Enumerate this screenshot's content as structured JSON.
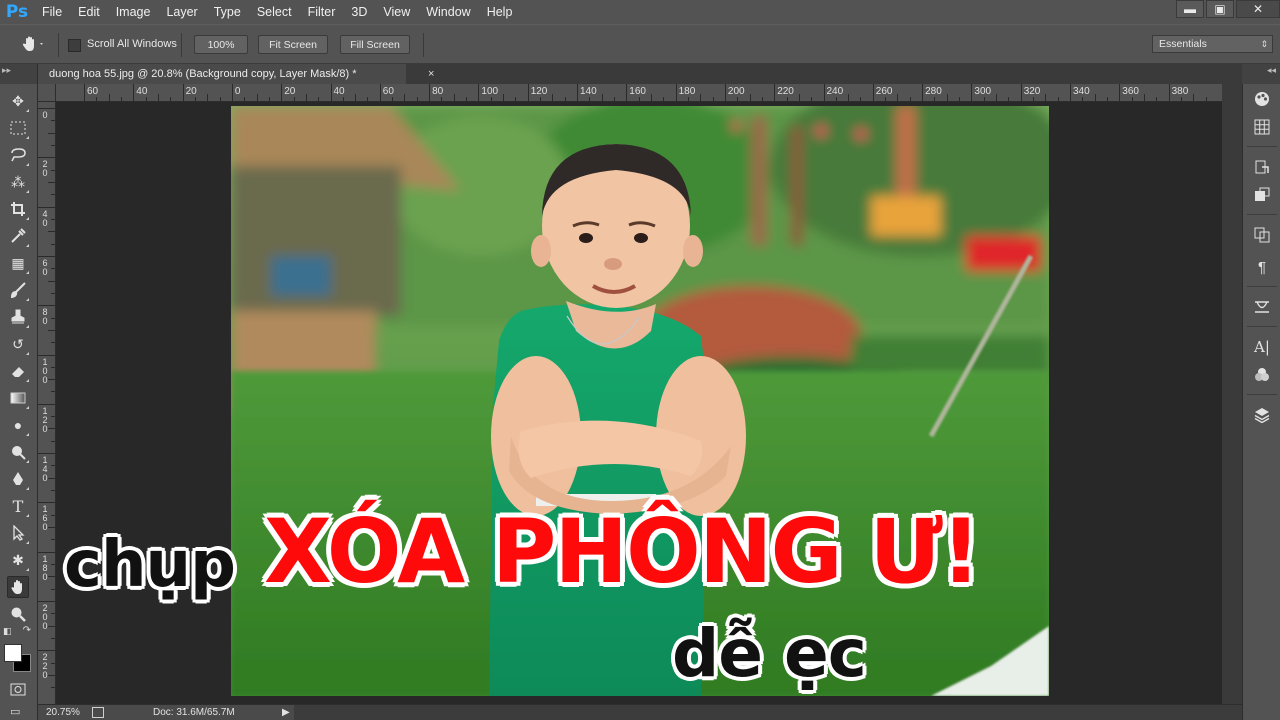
{
  "app": {
    "logo": "Ps"
  },
  "menu": [
    "File",
    "Edit",
    "Image",
    "Layer",
    "Type",
    "Select",
    "Filter",
    "3D",
    "View",
    "Window",
    "Help"
  ],
  "window_controls": {
    "minimize": "▬",
    "maximize": "▣",
    "close": "✕"
  },
  "options_bar": {
    "tool_icon": "hand-icon",
    "scroll_all_windows_label": "Scroll All Windows",
    "scroll_all_windows_checked": false,
    "zoom_100_label": "100%",
    "fit_screen_label": "Fit Screen",
    "fill_screen_label": "Fill Screen",
    "workspace": "Essentials"
  },
  "document": {
    "tab_title": "duong hoa 55.jpg @ 20.8% (Background copy, Layer Mask/8) *",
    "tab_close": "×"
  },
  "ruler": {
    "h_labels": [
      "60",
      "40",
      "20",
      "0",
      "20",
      "40",
      "60",
      "80",
      "100",
      "120",
      "140",
      "160",
      "180",
      "200",
      "220",
      "240",
      "260",
      "280",
      "300",
      "320",
      "340",
      "360",
      "380"
    ],
    "v_labels": [
      "0",
      "20",
      "40",
      "60",
      "80",
      "100",
      "120",
      "140",
      "160",
      "180",
      "200",
      "220"
    ]
  },
  "overlay": {
    "line1_black": "chụp",
    "line1_red": "XÓA PHÔNG Ư!",
    "line2_black": "dễ ẹc",
    "red_color": "#ff0a0a"
  },
  "tools": [
    "move-icon",
    "marquee-icon",
    "lasso-icon",
    "magic-wand-icon",
    "crop-icon",
    "eyedropper-icon",
    "healing-brush-icon",
    "brush-icon",
    "clone-stamp-icon",
    "history-brush-icon",
    "eraser-icon",
    "gradient-icon",
    "blur-icon",
    "dodge-icon",
    "pen-icon",
    "type-icon",
    "path-selection-icon",
    "shape-icon",
    "hand-icon",
    "zoom-icon"
  ],
  "right_panel_icons": [
    "color-panel-icon",
    "swatches-panel-icon",
    "history-panel-icon",
    "adjustments-panel-icon",
    "clone-source-panel-icon",
    "paragraph-panel-icon",
    "brush-panel-icon",
    "character-panel-icon",
    "channels-panel-icon",
    "layers-panel-icon"
  ],
  "status_bar": {
    "zoom": "20.75%",
    "doc_info": "Doc: 31.6M/65.7M",
    "arrow": "▶"
  }
}
